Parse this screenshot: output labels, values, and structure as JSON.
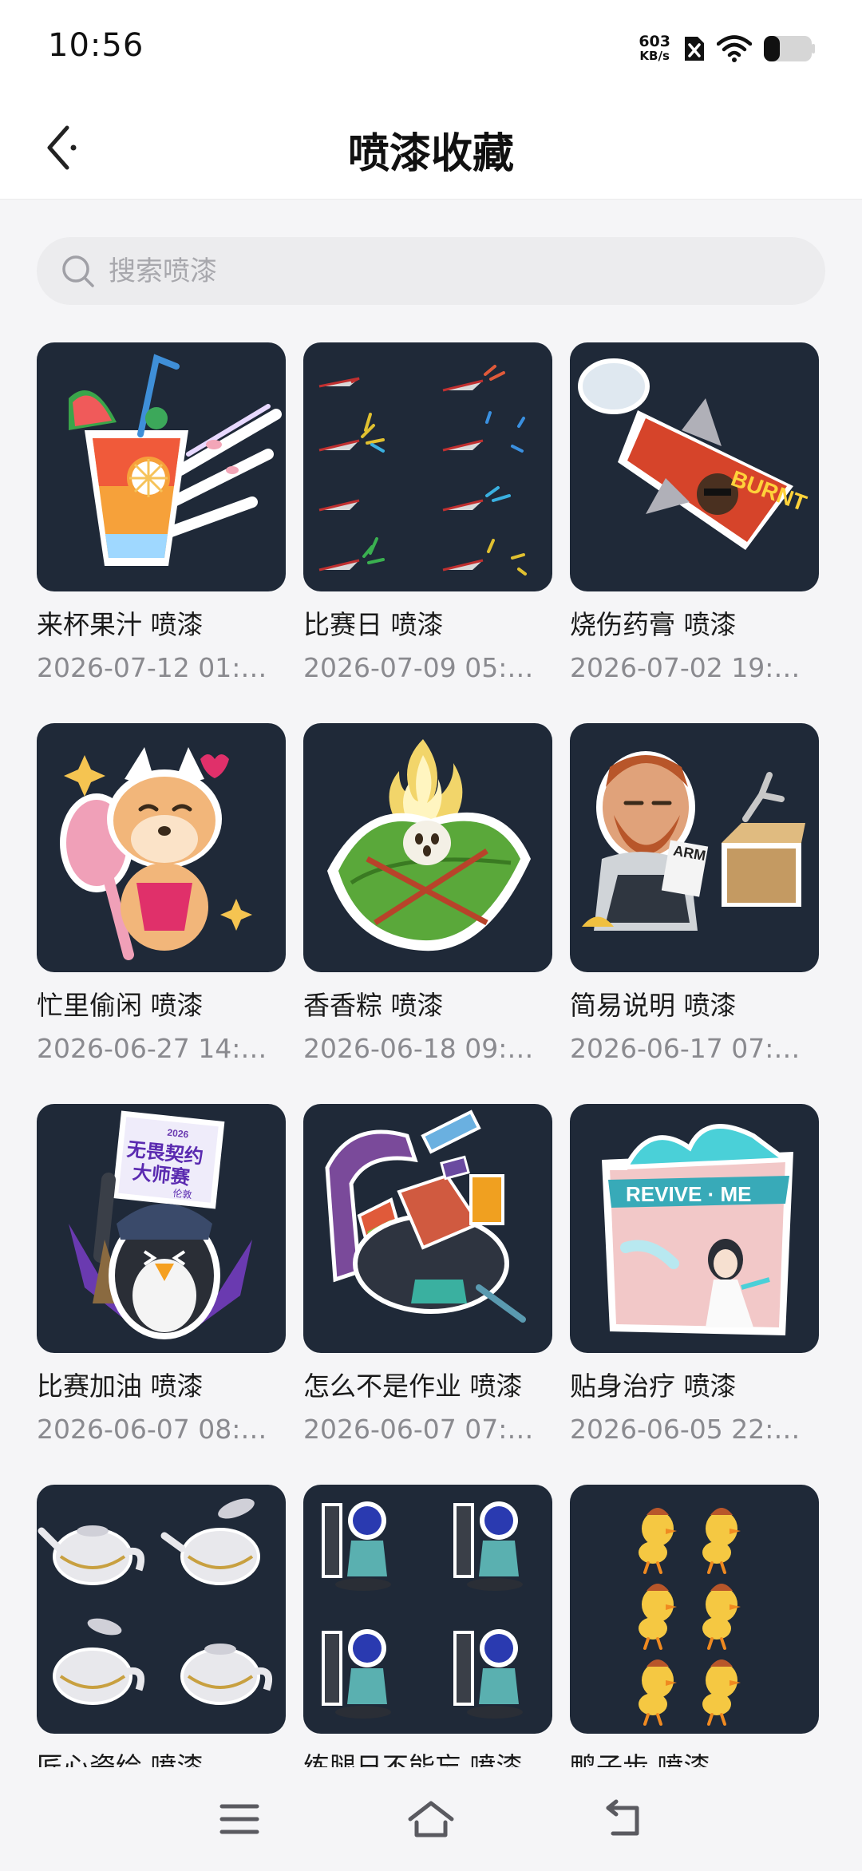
{
  "status_bar": {
    "time": "10:56",
    "net_speed_value": "603",
    "net_speed_unit": "KB/s"
  },
  "header": {
    "title": "喷漆收藏",
    "back_icon": "chevron-left-icon"
  },
  "search": {
    "placeholder": "搜索喷漆",
    "icon": "search-icon"
  },
  "sprays": [
    {
      "title": "来杯果汁 喷漆",
      "date": "2026-07-12 01:…",
      "art": "juice"
    },
    {
      "title": "比赛日 喷漆",
      "date": "2026-07-09 05:…",
      "art": "jets"
    },
    {
      "title": "烧伤药膏 喷漆",
      "date": "2026-07-02 19:…",
      "art": "burnt"
    },
    {
      "title": "忙里偷闲 喷漆",
      "date": "2026-06-27 14:…",
      "art": "shiba"
    },
    {
      "title": "香香粽 喷漆",
      "date": "2026-06-18 09:…",
      "art": "zongzi"
    },
    {
      "title": "简易说明 喷漆",
      "date": "2026-06-17 07:…",
      "art": "mechanic"
    },
    {
      "title": "比赛加油 喷漆",
      "date": "2026-06-07 08:…",
      "art": "penguin"
    },
    {
      "title": "怎么不是作业 喷漆",
      "date": "2026-06-07 07:…",
      "art": "bag"
    },
    {
      "title": "贴身治疗 喷漆",
      "date": "2026-06-05 22:…",
      "art": "revive"
    },
    {
      "title": "匠心瓷绘 喷漆",
      "date": "",
      "art": "teapots"
    },
    {
      "title": "练腿日不能忘 喷漆",
      "date": "",
      "art": "legday"
    },
    {
      "title": "鸭子步 喷漆",
      "date": "",
      "art": "ducks"
    }
  ],
  "art_text": {
    "burnt": "BURNT",
    "arm": "ARM",
    "penguin_sign_year": "2026",
    "penguin_sign_line1": "无畏契约",
    "penguin_sign_line2": "大师赛",
    "penguin_sign_line3": "伦敦",
    "revive": "REVIVE · ME"
  },
  "nav_bar": {
    "menu_icon": "menu-icon",
    "home_icon": "home-icon",
    "back_icon": "back-arrow-icon"
  },
  "colors": {
    "thumb_bg": "#1f2938",
    "date_text": "#8a8a8f",
    "page_bg": "#f5f5f7"
  }
}
